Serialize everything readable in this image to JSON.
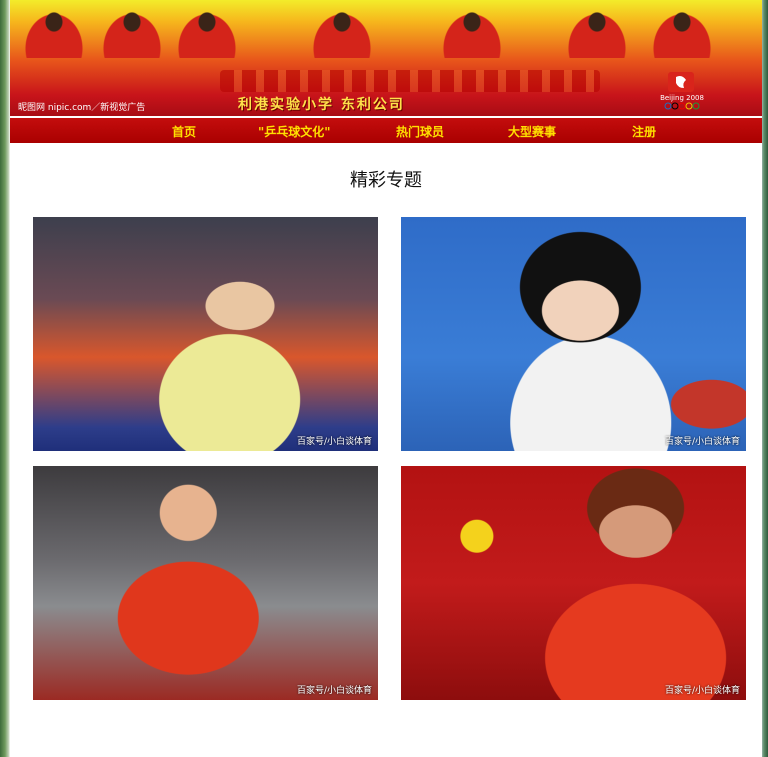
{
  "banner": {
    "school_line": "利港实验小学     东利公司",
    "brand_text": "昵图网 nipic.com／新视觉广告",
    "logo_text": "Beijing 2008",
    "colors": {
      "top": "#f3ec2a",
      "mid": "#e8561b",
      "bottom": "#a80c14"
    }
  },
  "nav": {
    "items": [
      {
        "label": "首页"
      },
      {
        "label": "\"乒乓球文化\""
      },
      {
        "label": "热门球员"
      },
      {
        "label": "大型赛事"
      },
      {
        "label": "注册"
      }
    ],
    "text_color": "#ffe000",
    "bg_color": "#b80606"
  },
  "section": {
    "title": "精彩专题"
  },
  "tiles": [
    {
      "caption": "百家号/小白谈体育"
    },
    {
      "caption": "百家号/小白谈体育"
    },
    {
      "caption": "百家号/小白谈体育"
    },
    {
      "caption": "百家号/小白谈体育"
    }
  ]
}
